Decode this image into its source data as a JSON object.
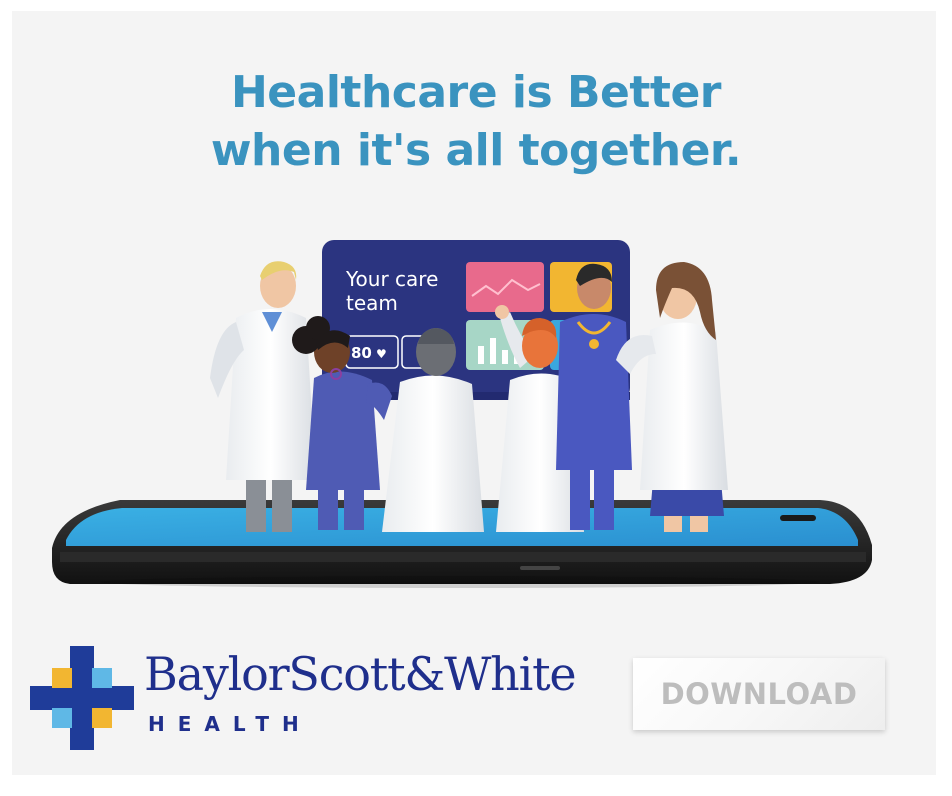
{
  "headline": {
    "line1": "Healthcare is Better",
    "line2": "when it's all together."
  },
  "screen": {
    "title_line1": "Your care",
    "title_line2": "team",
    "heart_rate": "80"
  },
  "brand": {
    "name": "BaylorScott&White",
    "sub": "HEALTH"
  },
  "download_button": {
    "label": "DOWNLOAD"
  },
  "colors": {
    "headline": "#3a93bf",
    "brand_navy": "#1f2f8c",
    "screen_navy": "#2b3480",
    "phone_screen": "#3aa7de",
    "logo_blue": "#1f3c99",
    "logo_yellow": "#f2b631",
    "logo_light_blue": "#5fb8e6"
  }
}
